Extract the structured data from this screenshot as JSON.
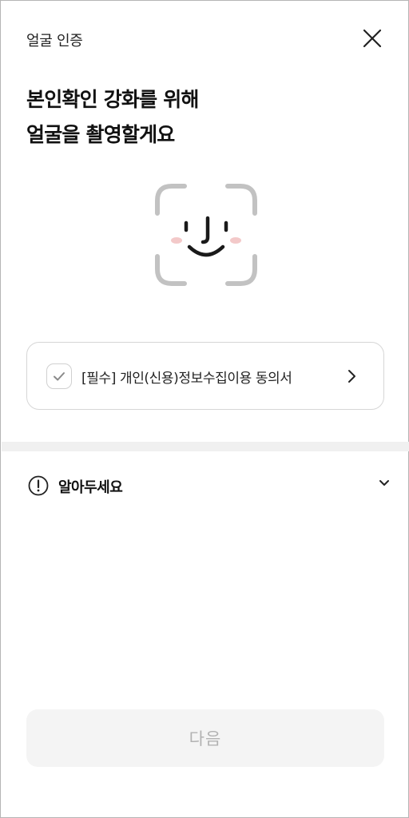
{
  "header": {
    "title": "얼굴 인증",
    "close_icon": "close-icon"
  },
  "headline": {
    "line1": "본인확인 강화를 위해",
    "line2": "얼굴을 촬영할게요"
  },
  "face_illustration": {
    "icon": "face-scan-icon",
    "frame_color": "#c2c2c2",
    "cheek_color": "#f3c9c9",
    "feature_color": "#1a1a1a"
  },
  "consent": {
    "label": "[필수] 개인(신용)정보수집이용 동의서",
    "checked": false,
    "check_icon": "check-icon",
    "arrow_icon": "chevron-right-icon"
  },
  "notice": {
    "label": "알아두세요",
    "icon": "exclamation-circle-icon",
    "chevron_icon": "chevron-down-icon"
  },
  "footer": {
    "next_label": "다음",
    "enabled": false
  }
}
